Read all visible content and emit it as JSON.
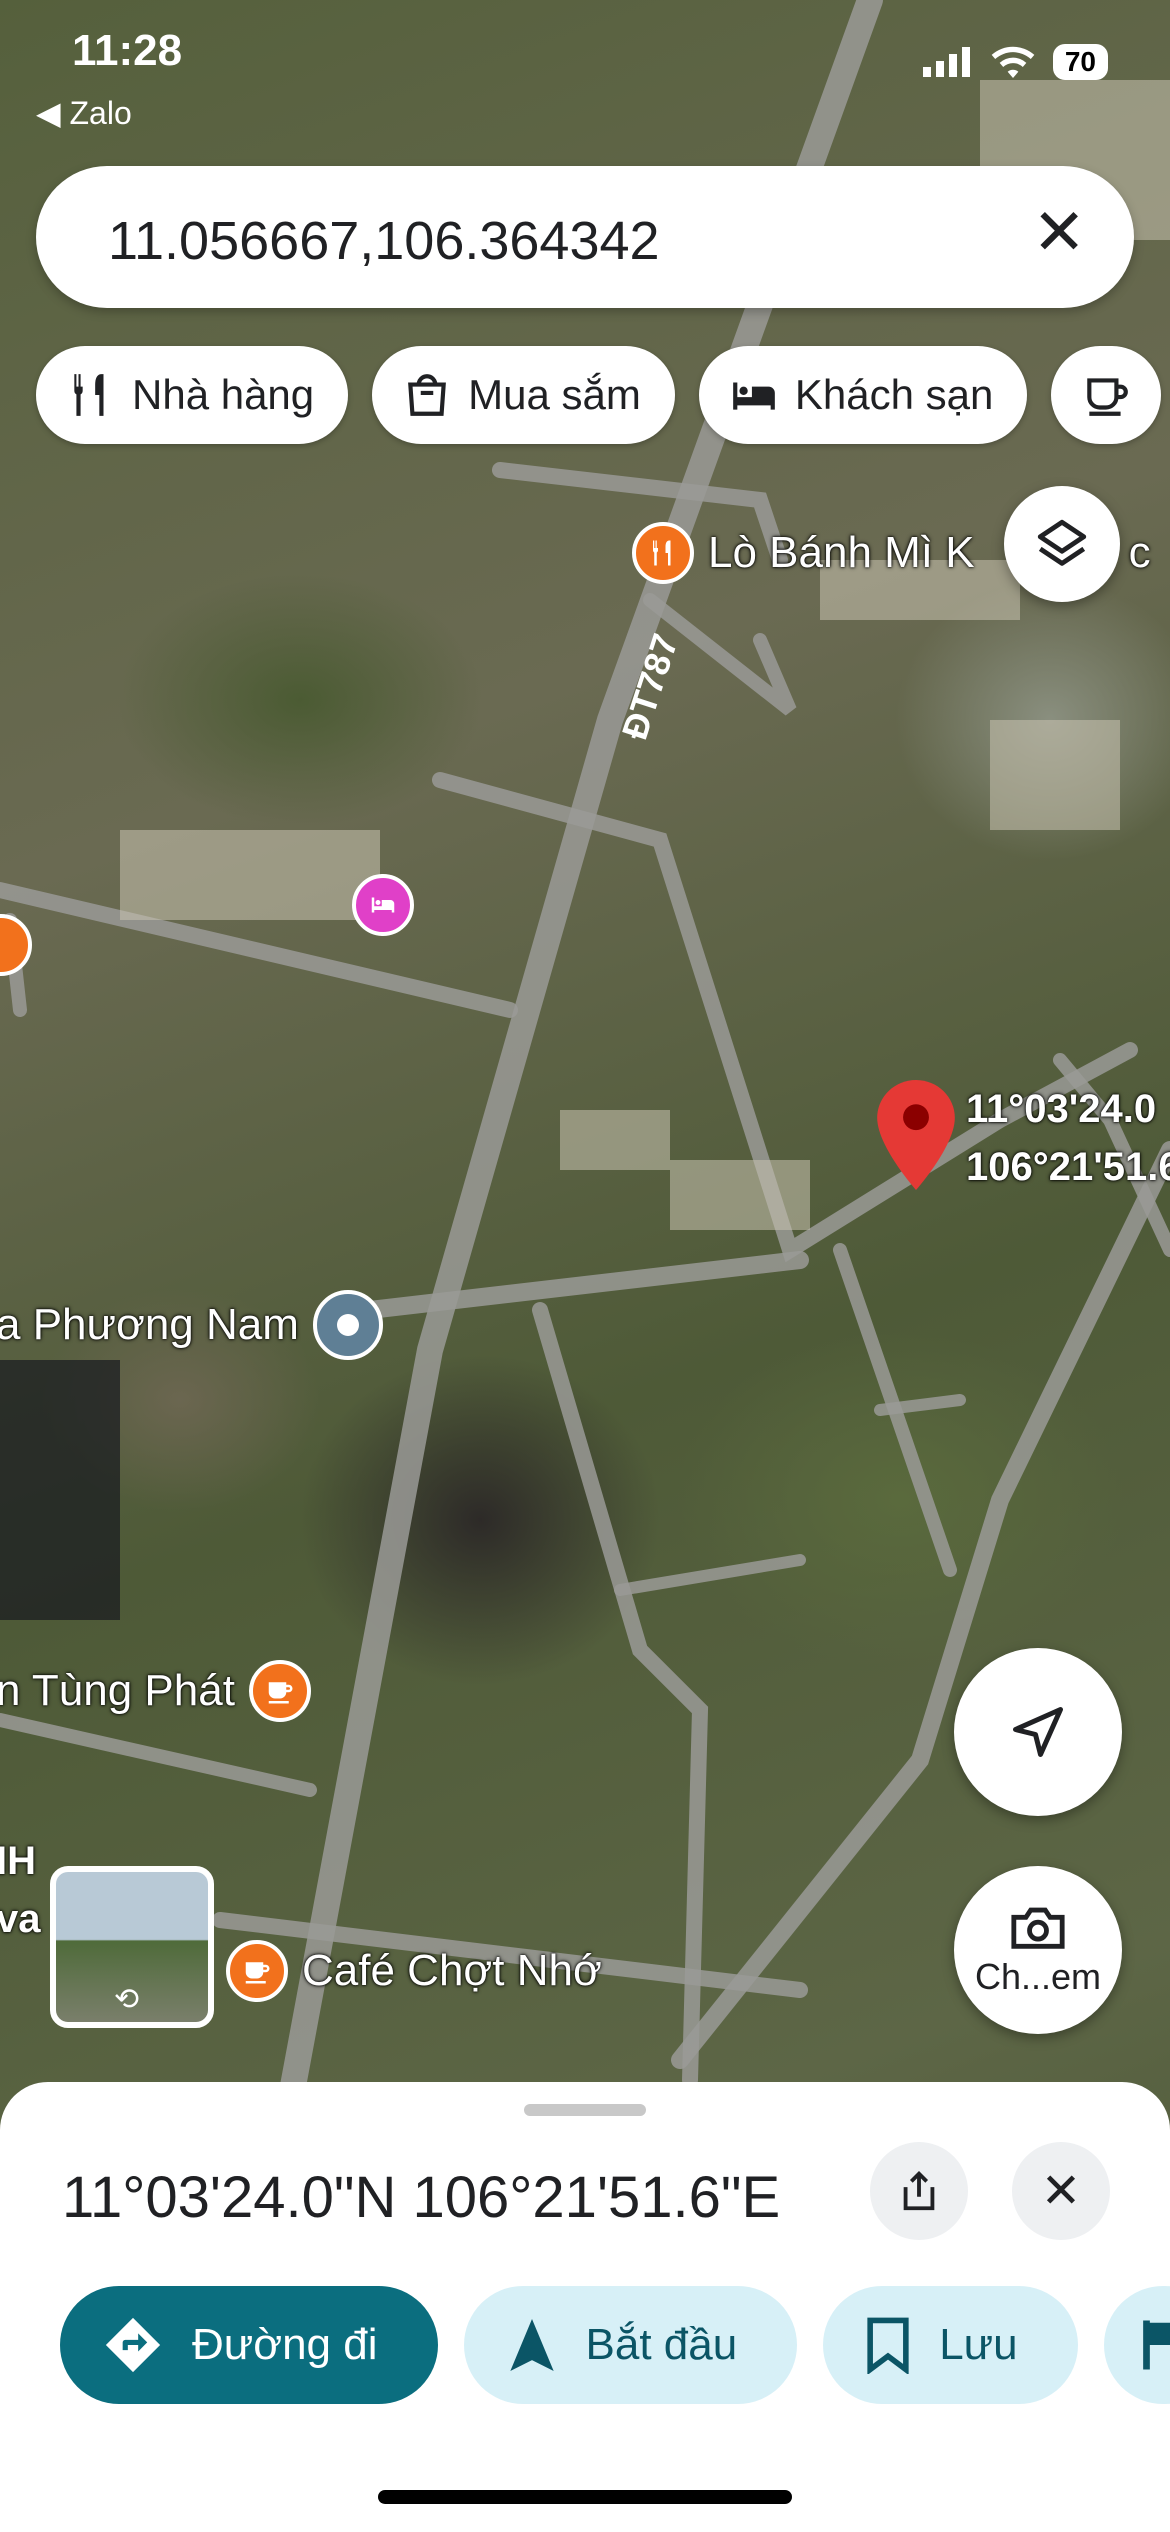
{
  "status_bar": {
    "time": "11:28",
    "back_app": "◀ Zalo",
    "battery": "70"
  },
  "search": {
    "value": "11.056667,106.364342",
    "close_icon": "close-icon"
  },
  "chips": [
    {
      "label": "Nhà hàng",
      "icon": "restaurant-icon"
    },
    {
      "label": "Mua sắm",
      "icon": "shopping-bag-icon"
    },
    {
      "label": "Khách sạn",
      "icon": "hotel-bed-icon"
    }
  ],
  "map": {
    "road_label": "ĐT787",
    "pin_label_line1": "11°03'24.0",
    "pin_label_line2": "106°21'51.6",
    "pois": {
      "bakery": "Lò Bánh Mì K",
      "bakery_tail": "c",
      "phuong_nam": "a Phương Nam",
      "tung_phat": "n Tùng Phát",
      "cafe": "Café Chợt Nhớ",
      "left_cut_1": "IH",
      "left_cut_2": "va"
    },
    "camera_label": "Ch...em"
  },
  "sheet": {
    "coordinates": "11°03'24.0\"N 106°21'51.6\"E",
    "actions": [
      {
        "label": "Đường đi",
        "icon": "directions-icon"
      },
      {
        "label": "Bắt đầu",
        "icon": "navigation-arrow-icon"
      },
      {
        "label": "Lưu",
        "icon": "bookmark-icon"
      }
    ]
  },
  "colors": {
    "primary": "#0b6e7f",
    "secondary_bg": "#d7f0f7",
    "pin_red": "#e53935",
    "poi_orange": "#f2711c",
    "poi_pink": "#e040c8"
  }
}
